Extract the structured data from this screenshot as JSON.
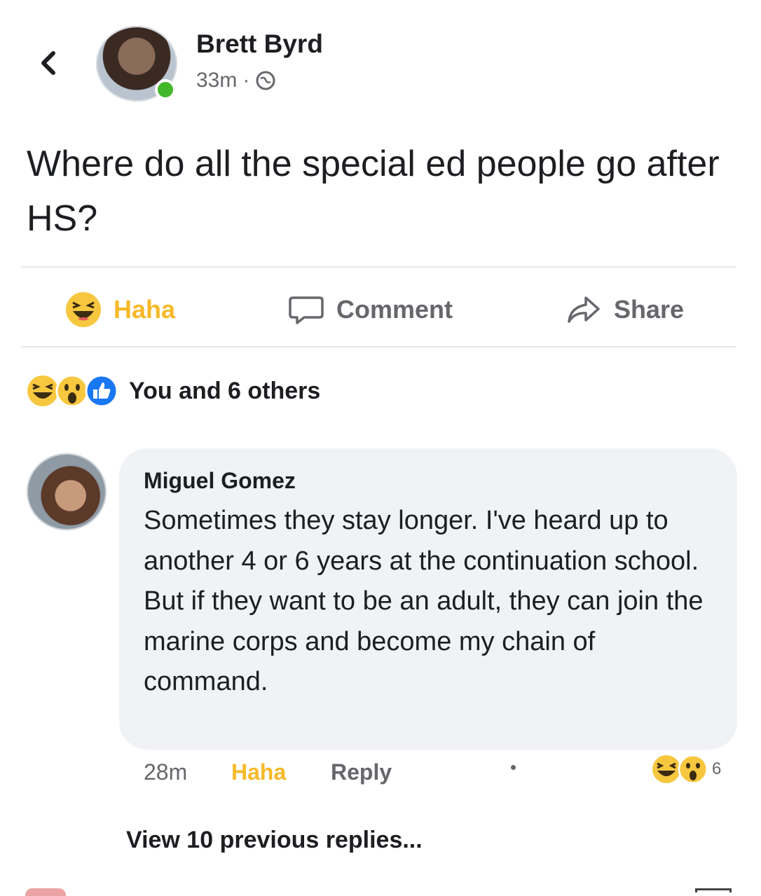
{
  "post": {
    "author": "Brett Byrd",
    "time": "33m",
    "separator": "·",
    "icons": {
      "back": "chevron-left-icon",
      "privacy": "globe-icon",
      "online": "online-status-dot"
    },
    "text": "Where do all the special ed people go after HS?"
  },
  "actions": {
    "haha_label": "Haha",
    "comment_label": "Comment",
    "share_label": "Share",
    "haha_color": "#f7b928"
  },
  "reactions_summary": {
    "icons": [
      "haha-icon",
      "wow-icon",
      "like-icon"
    ],
    "text": "You and 6 others"
  },
  "comment": {
    "author": "Miguel Gomez",
    "text": "Sometimes they stay longer. I've heard up to another 4 or 6 years at the continuation school. But if they want to be an adult, they can join the marine corps and become my chain of command.",
    "time": "28m",
    "haha_label": "Haha",
    "reply_label": "Reply",
    "reaction_icons": [
      "haha-icon",
      "wow-icon"
    ],
    "reaction_count": "6"
  },
  "view_replies": "View 10 previous replies...",
  "colors": {
    "text": "#1c1e21",
    "secondary": "#65676b",
    "bubble": "#f0f2f5",
    "haha": "#f7b928",
    "like": "#1877f2",
    "online": "#42b72a"
  }
}
